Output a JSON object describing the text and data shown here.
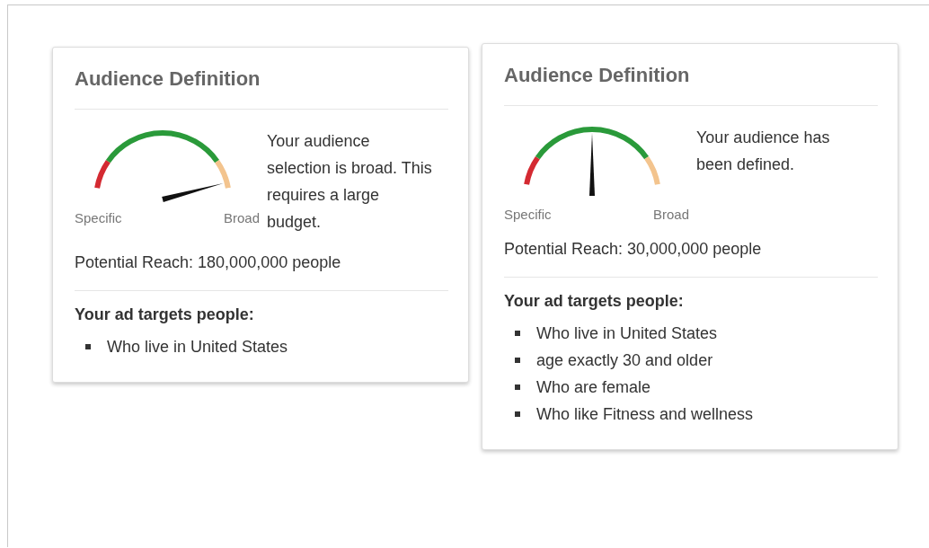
{
  "cards": [
    {
      "title": "Audience Definition",
      "gauge": {
        "kind": "broad",
        "left_label": "Specific",
        "right_label": "Broad"
      },
      "message": "Your audience selection is broad. This requires a large budget.",
      "reach": "Potential Reach: 180,000,000 people",
      "targets_heading": "Your ad targets people:",
      "targets": [
        "Who live in United States"
      ]
    },
    {
      "title": "Audience Definition",
      "gauge": {
        "kind": "defined",
        "left_label": "Specific",
        "right_label": "Broad"
      },
      "message": "Your audience has been defined.",
      "reach": "Potential Reach: 30,000,000 people",
      "targets_heading": "Your ad targets people:",
      "targets": [
        "Who live in United States",
        "age exactly 30 and older",
        "Who are female",
        "Who like Fitness and wellness"
      ]
    }
  ]
}
